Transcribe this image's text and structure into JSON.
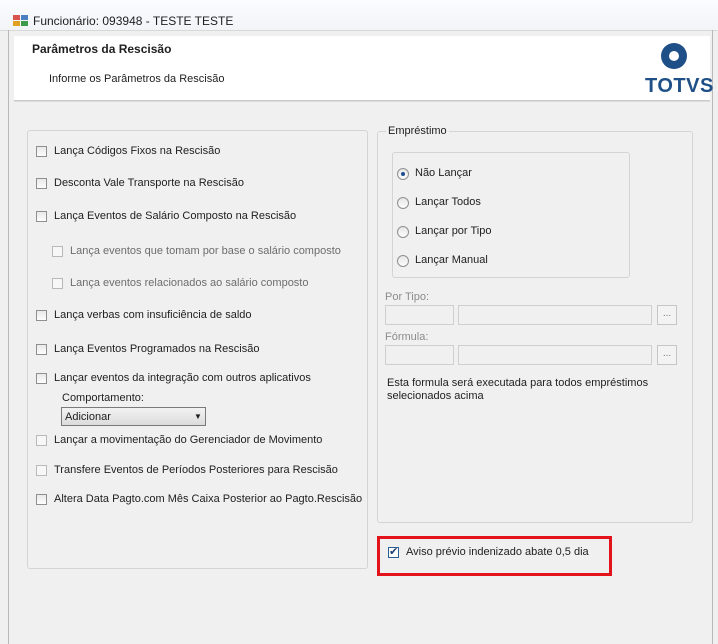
{
  "window": {
    "title": "Funcionário: 093948 - TESTE TESTE"
  },
  "header": {
    "title": "Parâmetros da Rescisão",
    "subtitle": "Informe os Parâmetros da Rescisão",
    "logo_text": "TOTVS",
    "brand_color": "#1f4f87"
  },
  "options": {
    "lanca_codigos_fixos": {
      "label": "Lança Códigos Fixos na Rescisão",
      "checked": false
    },
    "desconta_vale_transporte": {
      "label": "Desconta Vale Transporte na Rescisão",
      "checked": false
    },
    "lanca_eventos_salario_composto": {
      "label": "Lança Eventos de Salário Composto na Rescisão",
      "checked": false
    },
    "lanca_eventos_base": {
      "label": "Lança eventos que tomam por base o salário composto",
      "checked": false,
      "enabled": false
    },
    "lanca_eventos_relacionados": {
      "label": "Lança eventos relacionados ao salário composto",
      "checked": false,
      "enabled": false
    },
    "lanca_verbas_insuficiencia": {
      "label": "Lança verbas com insuficiência de saldo",
      "checked": false
    },
    "lanca_eventos_programados": {
      "label": "Lança Eventos Programados na Rescisão",
      "checked": false
    },
    "lancar_eventos_integracao": {
      "label": "Lançar eventos da integração com outros aplicativos",
      "checked": false
    },
    "comportamento": {
      "label": "Comportamento:",
      "value": "Adicionar"
    },
    "lancar_movimentacao": {
      "label": "Lançar a movimentação do Gerenciador de Movimento",
      "checked": false,
      "enabled": false
    },
    "transfere_eventos": {
      "label": "Transfere Eventos de Períodos Posteriores para Rescisão",
      "checked": false,
      "enabled": false
    },
    "altera_data_pagto": {
      "label": "Altera Data Pagto.com Mês Caixa Posterior ao Pagto.Rescisão",
      "checked": false
    }
  },
  "emprestimo": {
    "legend": "Empréstimo",
    "radios": [
      {
        "label": "Não Lançar",
        "selected": true
      },
      {
        "label": "Lançar Todos",
        "selected": false
      },
      {
        "label": "Lançar por Tipo",
        "selected": false
      },
      {
        "label": "Lançar Manual",
        "selected": false
      }
    ],
    "por_tipo_label": "Por Tipo:",
    "formula_label": "Fórmula:",
    "browse_label": "...",
    "note": "Esta formula será executada para todos empréstimos selecionados acima"
  },
  "aviso_previo": {
    "label": "Aviso prévio indenizado abate 0,5 dia",
    "checked": true
  },
  "highlight_color": "#e3131b"
}
